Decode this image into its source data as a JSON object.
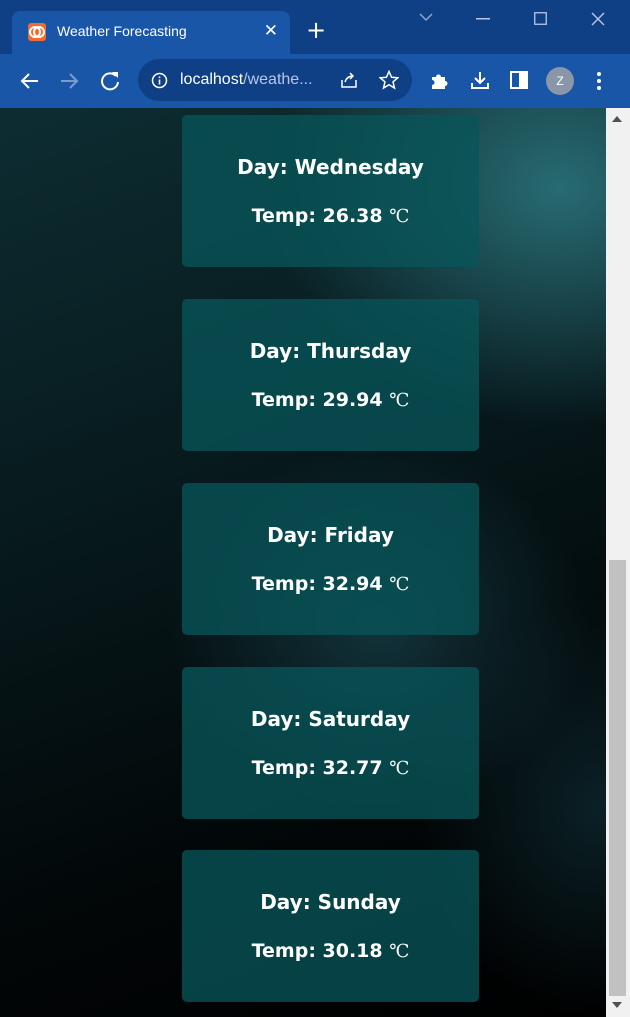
{
  "browser": {
    "tab_title": "Weather Forecasting",
    "tab_close": "✕",
    "new_tab": "+",
    "url_host": "localhost",
    "url_rest": "/weathe...",
    "profile_initial": "Z"
  },
  "forecast": [
    {
      "day_label": "Day: Wednesday",
      "temp_label": "Temp: 26.38",
      "unit": "℃"
    },
    {
      "day_label": "Day: Thursday",
      "temp_label": "Temp: 29.94",
      "unit": "℃"
    },
    {
      "day_label": "Day: Friday",
      "temp_label": "Temp: 32.94",
      "unit": "℃"
    },
    {
      "day_label": "Day: Saturday",
      "temp_label": "Temp: 32.77",
      "unit": "℃"
    },
    {
      "day_label": "Day: Sunday",
      "temp_label": "Temp: 30.18",
      "unit": "℃"
    }
  ],
  "colors": {
    "titlebar": "#0f3f85",
    "toolbar": "#1a56a8",
    "card": "#085458",
    "card_text": "#ffffff"
  },
  "icons": {
    "back": "arrow-left-icon",
    "forward": "arrow-right-icon",
    "reload": "reload-icon",
    "info": "info-icon",
    "share": "share-icon",
    "bookmark": "star-icon",
    "extensions": "puzzle-icon",
    "downloads": "download-icon",
    "sidepanel": "sidepanel-icon",
    "menu": "kebab-menu-icon"
  }
}
